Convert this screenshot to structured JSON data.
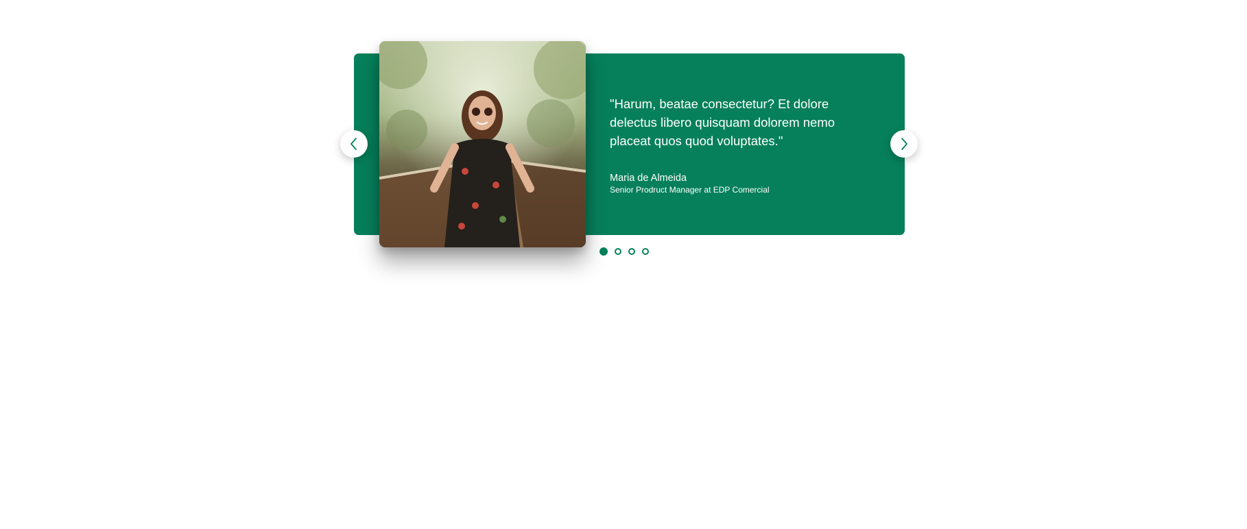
{
  "testimonial": {
    "quote": "\"Harum, beatae consectetur? Et dolore delectus libero quisquam dolorem nemo placeat quos quod voluptates.\"",
    "author_name": "Maria de Almeida",
    "author_role": "Senior Prodruct Manager at EDP Comercial"
  },
  "navigation": {
    "prev_icon": "chevron-left-icon",
    "next_icon": "chevron-right-icon"
  },
  "pagination": {
    "total": 4,
    "active_index": 0
  },
  "colors": {
    "accent": "#06805a",
    "text_on_accent": "#ffffff",
    "background": "#ffffff"
  }
}
